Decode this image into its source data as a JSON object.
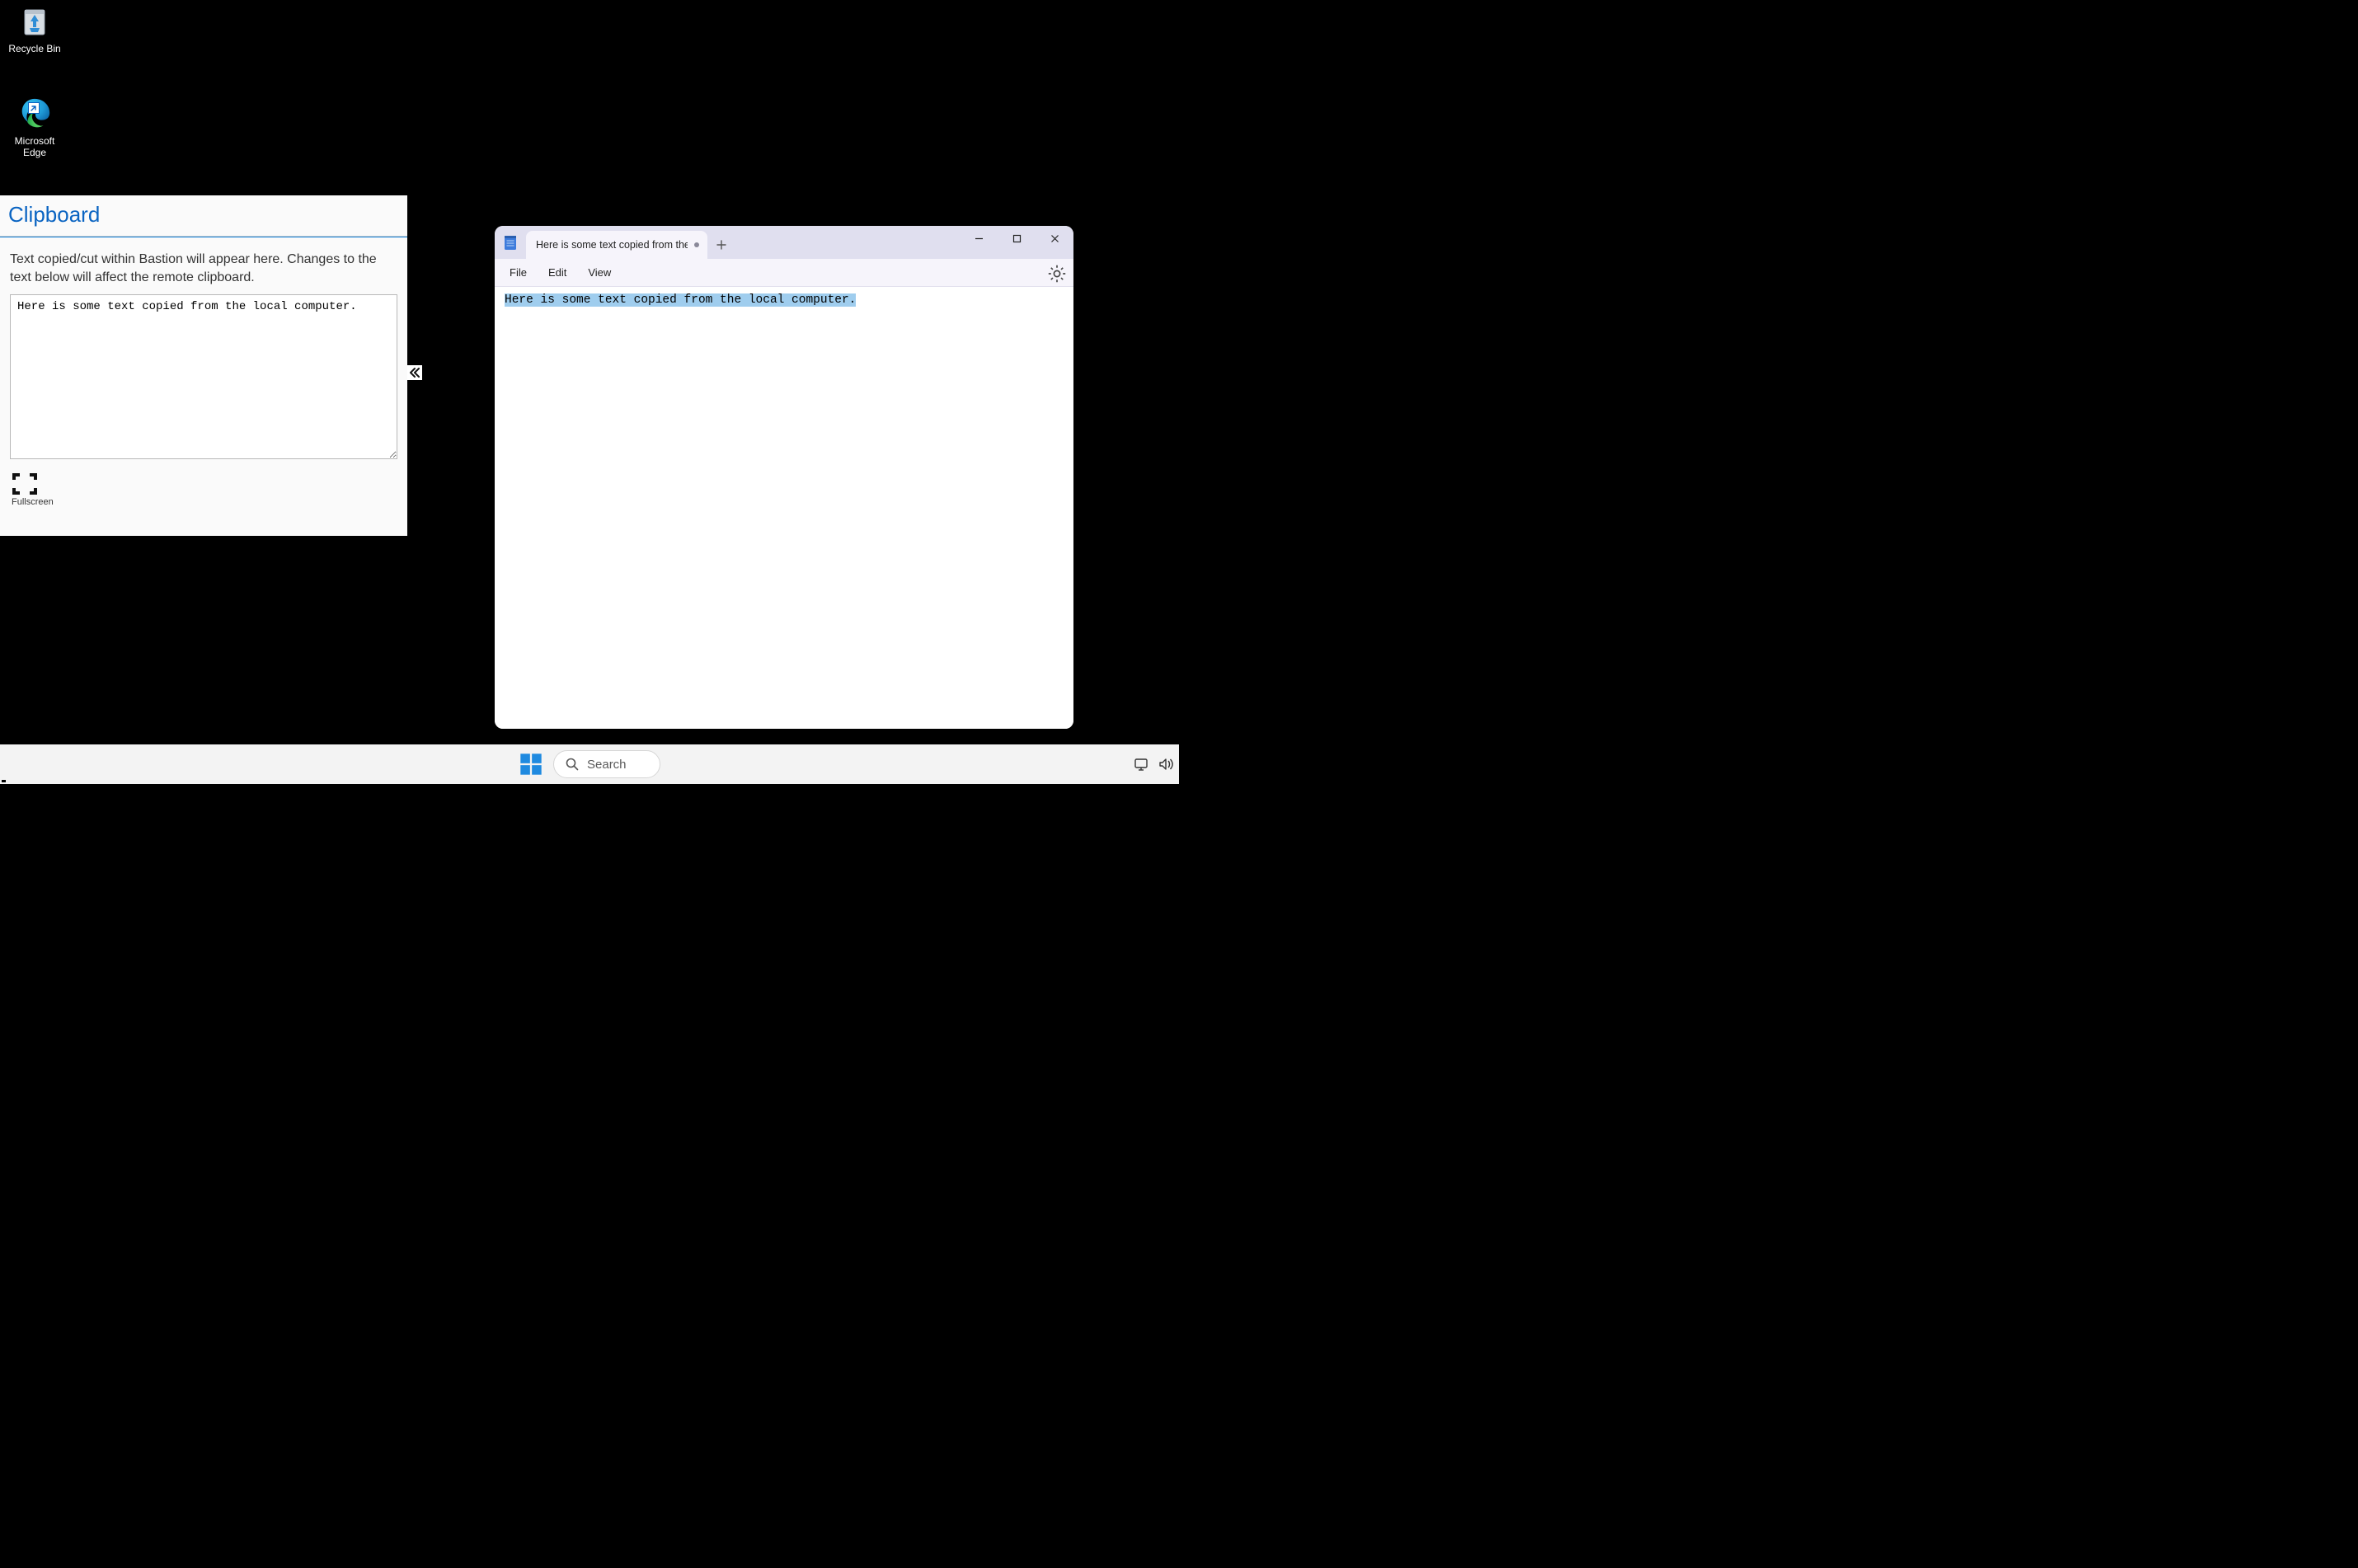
{
  "desktop": {
    "icons": [
      {
        "name": "recycle-bin",
        "label": "Recycle Bin"
      },
      {
        "name": "edge",
        "label": "Microsoft\nEdge"
      }
    ]
  },
  "clipboardPanel": {
    "title": "Clipboard",
    "description": "Text copied/cut within Bastion will appear here. Changes to the text below will affect the remote clipboard.",
    "textareaValue": "Here is some text copied from the local computer.",
    "fullscreenLabel": "Fullscreen"
  },
  "notepad": {
    "tabTitle": "Here is some text copied from the l",
    "menus": {
      "file": "File",
      "edit": "Edit",
      "view": "View"
    },
    "content": "Here is some text copied from the local computer."
  },
  "taskbar": {
    "searchPlaceholder": "Search"
  }
}
